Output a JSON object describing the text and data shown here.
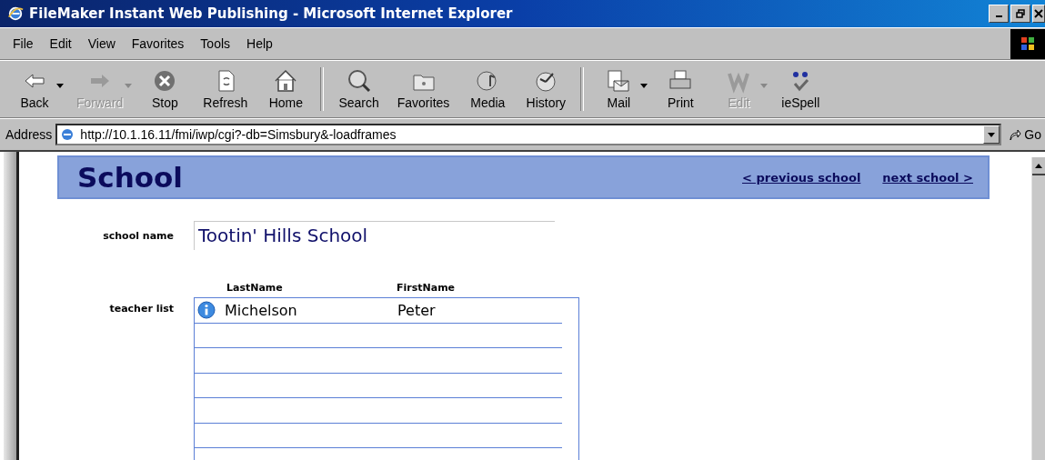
{
  "window": {
    "title": "FileMaker Instant Web Publishing - Microsoft Internet Explorer"
  },
  "menu": [
    "File",
    "Edit",
    "View",
    "Favorites",
    "Tools",
    "Help"
  ],
  "toolbar": [
    {
      "label": "Back",
      "kind": "back",
      "disabled": false,
      "dropdown": true
    },
    {
      "label": "Forward",
      "kind": "forward",
      "disabled": true,
      "dropdown": true
    },
    {
      "label": "Stop",
      "kind": "stop",
      "disabled": false,
      "dropdown": false
    },
    {
      "label": "Refresh",
      "kind": "refresh",
      "disabled": false,
      "dropdown": false
    },
    {
      "label": "Home",
      "kind": "home",
      "disabled": false,
      "dropdown": false
    },
    {
      "label": "Search",
      "kind": "search",
      "disabled": false,
      "dropdown": false
    },
    {
      "label": "Favorites",
      "kind": "favorites",
      "disabled": false,
      "dropdown": false
    },
    {
      "label": "Media",
      "kind": "media",
      "disabled": false,
      "dropdown": false
    },
    {
      "label": "History",
      "kind": "history",
      "disabled": false,
      "dropdown": false
    },
    {
      "label": "Mail",
      "kind": "mail",
      "disabled": false,
      "dropdown": true
    },
    {
      "label": "Print",
      "kind": "print",
      "disabled": false,
      "dropdown": false
    },
    {
      "label": "Edit",
      "kind": "edit",
      "disabled": true,
      "dropdown": true
    },
    {
      "label": "ieSpell",
      "kind": "spell",
      "disabled": false,
      "dropdown": false
    }
  ],
  "address": {
    "label": "Address",
    "value": "http://10.1.16.11/fmi/iwp/cgi?-db=Simsbury&-loadframes",
    "go": "Go"
  },
  "page": {
    "title": "School",
    "previous_link": "< previous school",
    "next_link": "next school >",
    "school_name_label": "school name",
    "school_name": "Tootin' Hills School",
    "teacher_list_label": "teacher list",
    "columns": [
      "LastName",
      "FirstName"
    ],
    "teachers": [
      {
        "last_name": "Michelson",
        "first_name": "Peter"
      }
    ]
  }
}
